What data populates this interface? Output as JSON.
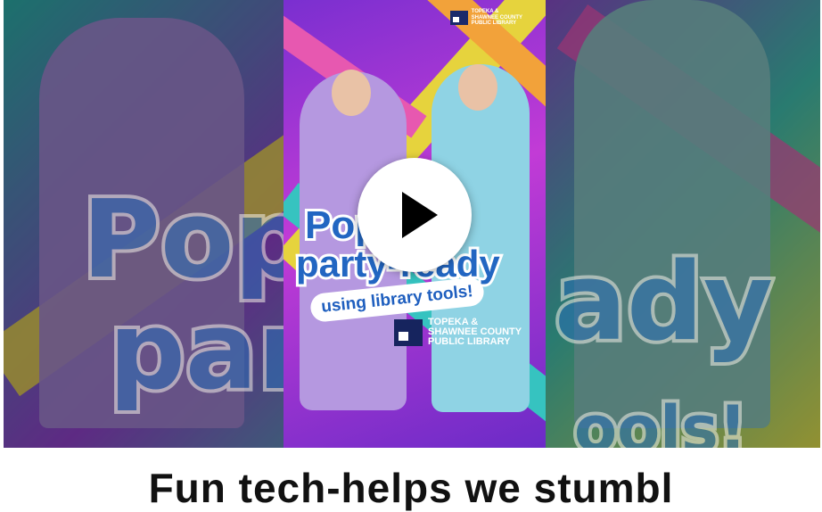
{
  "video": {
    "poster_logo_small": "TOPEKA &\nSHAWNEE COUNTY\nPUBLIC LIBRARY",
    "poster_line1": "Pop",
    "poster_line2": "party-ready",
    "poster_pill": "using library tools!",
    "poster_logo_big": "TOPEKA &\nSHAWNEE COUNTY\nPUBLIC LIBRARY",
    "bg_text_1": "Pop",
    "bg_text_2": "par",
    "bg_text_3": "ady",
    "bg_text_4": "ools!",
    "play_icon": "play-icon"
  },
  "caption": "Fun tech-helps we stumbl",
  "colors": {
    "brand_blue": "#2266c2",
    "background": "#ffffff",
    "caption": "#111111"
  }
}
